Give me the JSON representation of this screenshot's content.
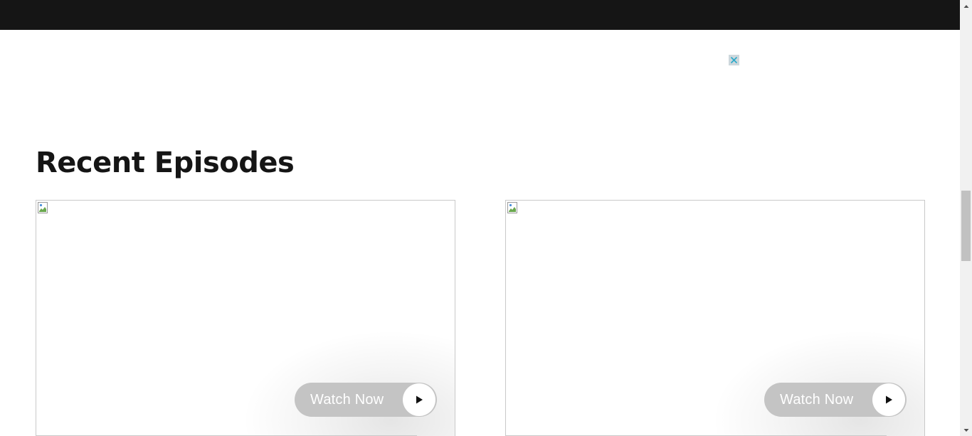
{
  "ad": {
    "close_icon": "close-icon",
    "close_color": "#2aa9c9"
  },
  "section": {
    "title": "Recent Episodes"
  },
  "episodes": [
    {
      "watch_label": "Watch Now",
      "play_icon": "play-icon"
    },
    {
      "watch_label": "Watch Now",
      "play_icon": "play-icon"
    }
  ],
  "colors": {
    "top_bar": "#151515",
    "title_text": "#151515",
    "watch_button_bg": "#c4c4c4",
    "watch_button_text": "#ffffff"
  }
}
